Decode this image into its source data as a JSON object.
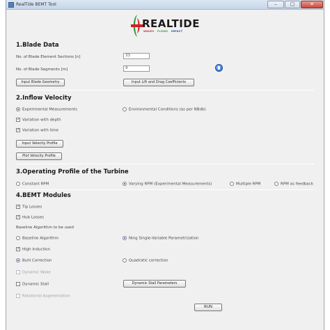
{
  "window": {
    "title": "RealTide BEMT Tool"
  },
  "logo": {
    "text": "REALTIDE",
    "sub": [
      "WAVES",
      "FLOWS",
      "IMPACT"
    ]
  },
  "sections": {
    "blade": "1.Blade Data",
    "inflow": "2.Inflow Velocity",
    "operating": "3.Operating Profile of the Turbine",
    "bemt": "4.BEMT Modules"
  },
  "blade": {
    "sections_label": "No. of Blade Element Sections [n]",
    "sections_value": "33",
    "segments_label": "No. of Blade Segments [m]",
    "segments_value": "9",
    "input_geometry": "Input Blade Geometry",
    "input_coeffs": "Input Lift and Drag Coefficients"
  },
  "inflow": {
    "experimental": "Experimental Measurements",
    "environmental": "Environmental Conditions (as per NBdb)",
    "variation_depth": "Variation with depth",
    "variation_time": "Variation with time",
    "input_profile": "Input Velocity Profile",
    "plot_profile": "Plot Velocity Profile"
  },
  "operating": {
    "constant": "Constant RPM",
    "varying": "Varying RPM (Experimental Measurements)",
    "multiple": "Multiple RPM",
    "feedback": "RPM as feedback"
  },
  "bemt": {
    "tip_losses": "Tip Losses",
    "hub_losses": "Hub Losses",
    "algorithm_label": "Baseline Algorithm to be used",
    "baseline": "Baseline Algorithm",
    "ning": "Ning Single-Variable Parametrization",
    "high_induction": "High Induction",
    "buhl": "Buhl Correction",
    "quadratic": "Quadratic correction",
    "dynamic_wake": "Dynamic Wake",
    "dynamic_stall": "Dynamic Stall",
    "dynamic_stall_params": "Dynamic Stall Parameters",
    "rotational": "Rotational Augmentation"
  },
  "run": "RUN",
  "icons": {
    "check": "✓",
    "info": "info-icon",
    "minimize": "–",
    "maximize": "□",
    "close": "✕"
  },
  "colors": {
    "logo_red": "#d21f26",
    "logo_green": "#2e9b3f",
    "logo_blue": "#1f4ea8"
  }
}
